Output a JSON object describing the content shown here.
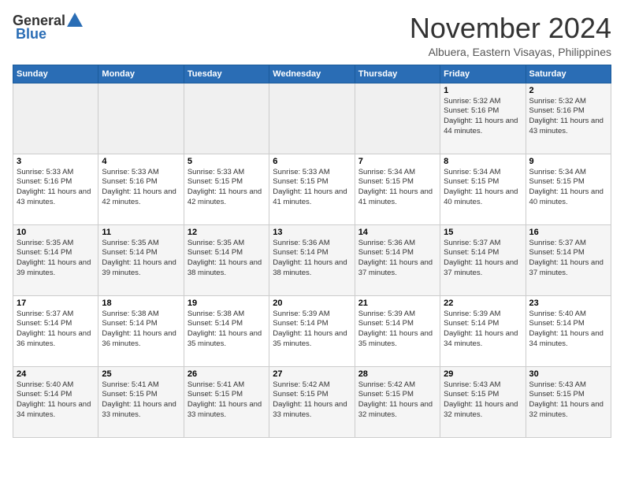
{
  "header": {
    "logo_general": "General",
    "logo_blue": "Blue",
    "month_title": "November 2024",
    "location": "Albuera, Eastern Visayas, Philippines"
  },
  "days_of_week": [
    "Sunday",
    "Monday",
    "Tuesday",
    "Wednesday",
    "Thursday",
    "Friday",
    "Saturday"
  ],
  "weeks": [
    [
      {
        "day": "",
        "info": ""
      },
      {
        "day": "",
        "info": ""
      },
      {
        "day": "",
        "info": ""
      },
      {
        "day": "",
        "info": ""
      },
      {
        "day": "",
        "info": ""
      },
      {
        "day": "1",
        "info": "Sunrise: 5:32 AM\nSunset: 5:16 PM\nDaylight: 11 hours and 44 minutes."
      },
      {
        "day": "2",
        "info": "Sunrise: 5:32 AM\nSunset: 5:16 PM\nDaylight: 11 hours and 43 minutes."
      }
    ],
    [
      {
        "day": "3",
        "info": "Sunrise: 5:33 AM\nSunset: 5:16 PM\nDaylight: 11 hours and 43 minutes."
      },
      {
        "day": "4",
        "info": "Sunrise: 5:33 AM\nSunset: 5:16 PM\nDaylight: 11 hours and 42 minutes."
      },
      {
        "day": "5",
        "info": "Sunrise: 5:33 AM\nSunset: 5:15 PM\nDaylight: 11 hours and 42 minutes."
      },
      {
        "day": "6",
        "info": "Sunrise: 5:33 AM\nSunset: 5:15 PM\nDaylight: 11 hours and 41 minutes."
      },
      {
        "day": "7",
        "info": "Sunrise: 5:34 AM\nSunset: 5:15 PM\nDaylight: 11 hours and 41 minutes."
      },
      {
        "day": "8",
        "info": "Sunrise: 5:34 AM\nSunset: 5:15 PM\nDaylight: 11 hours and 40 minutes."
      },
      {
        "day": "9",
        "info": "Sunrise: 5:34 AM\nSunset: 5:15 PM\nDaylight: 11 hours and 40 minutes."
      }
    ],
    [
      {
        "day": "10",
        "info": "Sunrise: 5:35 AM\nSunset: 5:14 PM\nDaylight: 11 hours and 39 minutes."
      },
      {
        "day": "11",
        "info": "Sunrise: 5:35 AM\nSunset: 5:14 PM\nDaylight: 11 hours and 39 minutes."
      },
      {
        "day": "12",
        "info": "Sunrise: 5:35 AM\nSunset: 5:14 PM\nDaylight: 11 hours and 38 minutes."
      },
      {
        "day": "13",
        "info": "Sunrise: 5:36 AM\nSunset: 5:14 PM\nDaylight: 11 hours and 38 minutes."
      },
      {
        "day": "14",
        "info": "Sunrise: 5:36 AM\nSunset: 5:14 PM\nDaylight: 11 hours and 37 minutes."
      },
      {
        "day": "15",
        "info": "Sunrise: 5:37 AM\nSunset: 5:14 PM\nDaylight: 11 hours and 37 minutes."
      },
      {
        "day": "16",
        "info": "Sunrise: 5:37 AM\nSunset: 5:14 PM\nDaylight: 11 hours and 37 minutes."
      }
    ],
    [
      {
        "day": "17",
        "info": "Sunrise: 5:37 AM\nSunset: 5:14 PM\nDaylight: 11 hours and 36 minutes."
      },
      {
        "day": "18",
        "info": "Sunrise: 5:38 AM\nSunset: 5:14 PM\nDaylight: 11 hours and 36 minutes."
      },
      {
        "day": "19",
        "info": "Sunrise: 5:38 AM\nSunset: 5:14 PM\nDaylight: 11 hours and 35 minutes."
      },
      {
        "day": "20",
        "info": "Sunrise: 5:39 AM\nSunset: 5:14 PM\nDaylight: 11 hours and 35 minutes."
      },
      {
        "day": "21",
        "info": "Sunrise: 5:39 AM\nSunset: 5:14 PM\nDaylight: 11 hours and 35 minutes."
      },
      {
        "day": "22",
        "info": "Sunrise: 5:39 AM\nSunset: 5:14 PM\nDaylight: 11 hours and 34 minutes."
      },
      {
        "day": "23",
        "info": "Sunrise: 5:40 AM\nSunset: 5:14 PM\nDaylight: 11 hours and 34 minutes."
      }
    ],
    [
      {
        "day": "24",
        "info": "Sunrise: 5:40 AM\nSunset: 5:14 PM\nDaylight: 11 hours and 34 minutes."
      },
      {
        "day": "25",
        "info": "Sunrise: 5:41 AM\nSunset: 5:15 PM\nDaylight: 11 hours and 33 minutes."
      },
      {
        "day": "26",
        "info": "Sunrise: 5:41 AM\nSunset: 5:15 PM\nDaylight: 11 hours and 33 minutes."
      },
      {
        "day": "27",
        "info": "Sunrise: 5:42 AM\nSunset: 5:15 PM\nDaylight: 11 hours and 33 minutes."
      },
      {
        "day": "28",
        "info": "Sunrise: 5:42 AM\nSunset: 5:15 PM\nDaylight: 11 hours and 32 minutes."
      },
      {
        "day": "29",
        "info": "Sunrise: 5:43 AM\nSunset: 5:15 PM\nDaylight: 11 hours and 32 minutes."
      },
      {
        "day": "30",
        "info": "Sunrise: 5:43 AM\nSunset: 5:15 PM\nDaylight: 11 hours and 32 minutes."
      }
    ]
  ]
}
